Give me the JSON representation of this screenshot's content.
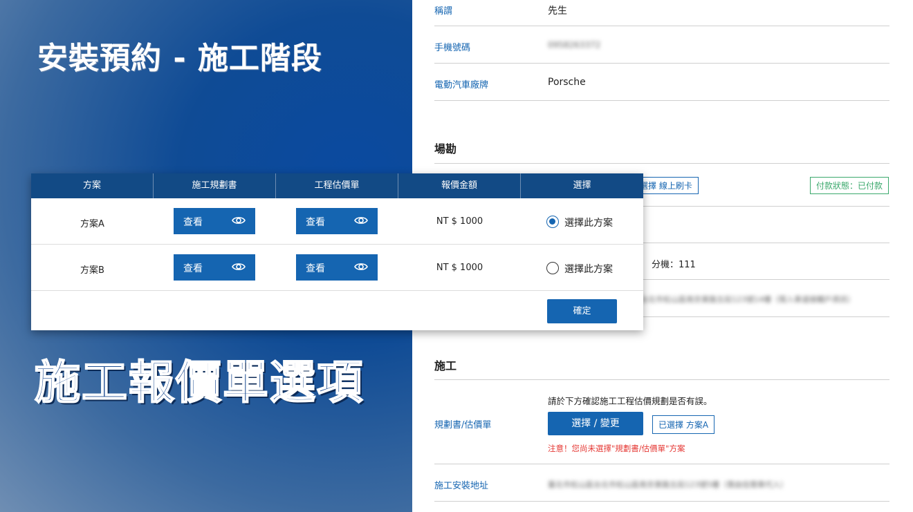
{
  "banner": {
    "headline": "安裝預約 - 施工階段",
    "subheadline": "施工報價單選項"
  },
  "form": {
    "fields": [
      {
        "label": "稱謂",
        "value": "先生"
      },
      {
        "label": "手機號碼",
        "value": "0958263372"
      },
      {
        "label": "電動汽車廠牌",
        "value": "Porsche"
      }
    ],
    "survey_section": {
      "title": "場勘",
      "payment_method_tag": "選擇 線上刷卡",
      "payment_status_tag": "付款狀態：已付款",
      "extension": "分機：111",
      "address_blurred": "台北市松山區南京東路五段123號14樓（限入車道接觸戶資訊）"
    },
    "construction_section": {
      "title": "施工",
      "plan_label": "規劃書/估價單",
      "note": "請於下方確認施工工程估價規劃是否有誤。",
      "select_change_button": "選擇 / 變更",
      "selected_tag": "已選擇 方案A",
      "warning": "注意！您尚未選擇\"規劃書/估價單\"方案",
      "address_label": "施工安裝地址",
      "address_blurred": "臺北市松山區台北市松山區南京東路五段123號5樓（需由信需車代入）"
    }
  },
  "popup": {
    "headers": [
      "方案",
      "施工規劃書",
      "工程估價單",
      "報價金額",
      "選擇"
    ],
    "rows": [
      {
        "plan": "方案A",
        "view1": "查看",
        "view2": "查看",
        "price": "NT $  1000",
        "choice": "選擇此方案",
        "selected": true
      },
      {
        "plan": "方案B",
        "view1": "查看",
        "view2": "查看",
        "price": "NT $  1000",
        "choice": "選擇此方案",
        "selected": false
      }
    ],
    "confirm_button": "確定"
  },
  "colors": {
    "primary": "#1565b1",
    "header_bg": "#124a85",
    "success": "#3aa86b",
    "warning": "#e53935"
  }
}
